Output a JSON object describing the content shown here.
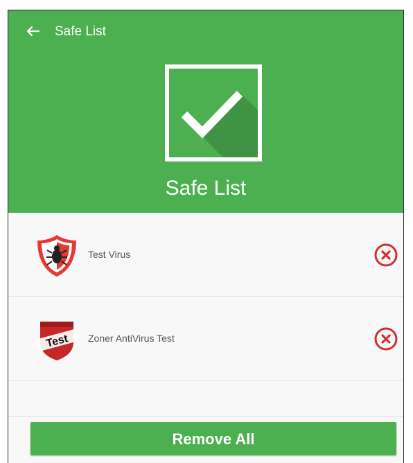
{
  "header": {
    "back_icon": "arrow-left-icon",
    "title": "Safe List",
    "main_icon": "checkmark-icon",
    "heading": "Safe List"
  },
  "items": [
    {
      "label": "Test Virus",
      "icon": "bug-shield-icon"
    },
    {
      "label": "Zoner AntiVirus Test",
      "icon": "test-shield-icon"
    }
  ],
  "actions": {
    "remove_all_label": "Remove All"
  },
  "colors": {
    "primary": "#4caf50",
    "remove": "#d32f2f"
  }
}
